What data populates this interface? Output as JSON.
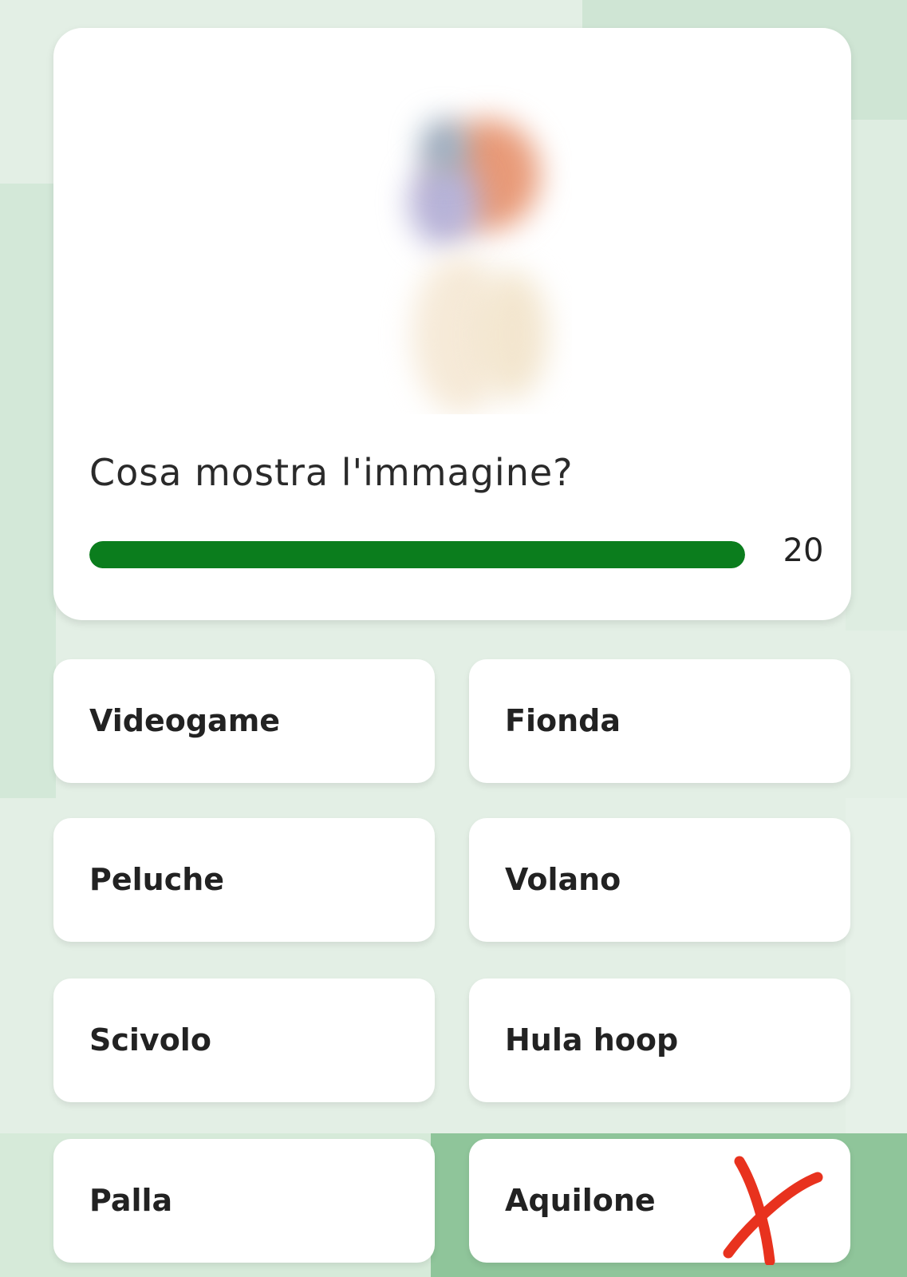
{
  "quiz": {
    "question": "Cosa mostra l'immagine?",
    "timer": {
      "value": "20",
      "progress_fraction": 1.0,
      "color": "#0b7d1d"
    }
  },
  "answers": [
    {
      "label": "Videogame"
    },
    {
      "label": "Fionda"
    },
    {
      "label": "Peluche"
    },
    {
      "label": "Volano"
    },
    {
      "label": "Scivolo"
    },
    {
      "label": "Hula hoop"
    },
    {
      "label": "Palla"
    },
    {
      "label": "Aquilone"
    }
  ],
  "annotation": {
    "icon": "red-x-mark-icon",
    "color": "#e8321e"
  }
}
